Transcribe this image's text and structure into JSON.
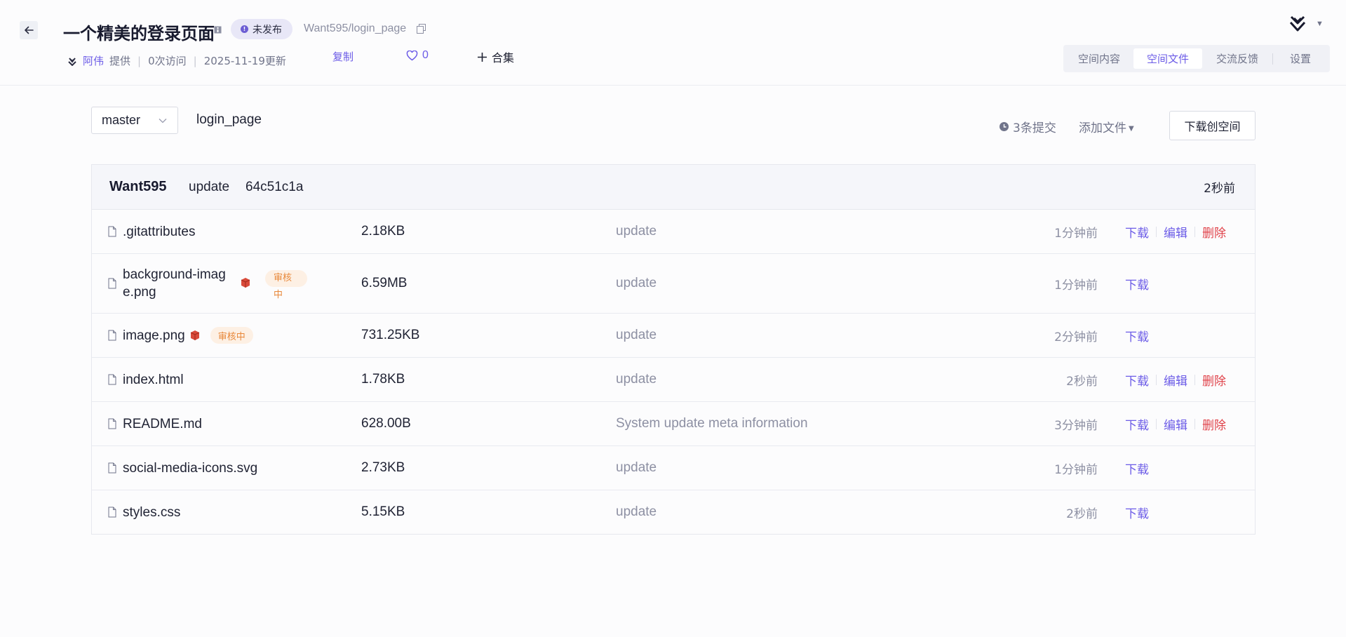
{
  "header": {
    "title": "一个精美的登录页面",
    "status": "未发布",
    "repo_path": "Want595/login_page",
    "author": "阿伟",
    "provide_label": "提供",
    "visits": "0次访问",
    "updated": "2025-11-19更新",
    "copy_label": "复制",
    "like_count": "0",
    "collection_label": "合集",
    "tabs": [
      {
        "label": "空间内容",
        "active": false
      },
      {
        "label": "空间文件",
        "active": true
      },
      {
        "label": "交流反馈",
        "active": false
      },
      {
        "label": "设置",
        "active": false
      }
    ]
  },
  "toolbar": {
    "branch": "master",
    "repo_name": "login_page",
    "commits_label": "3条提交",
    "add_file_label": "添加文件",
    "download_space_label": "下载创空间"
  },
  "latest_commit": {
    "author": "Want595",
    "message": "update",
    "hash": "64c51c1a",
    "time": "2秒前"
  },
  "actions": {
    "download": "下载",
    "edit": "编辑",
    "delete": "删除"
  },
  "review_label": "审核中",
  "files": [
    {
      "name": ".gitattributes",
      "size": "2.18KB",
      "message": "update",
      "time": "1分钟前",
      "editable": true
    },
    {
      "name": "background-image.png",
      "name_line1": "background-imag",
      "name_line2": "e.png",
      "size": "6.59MB",
      "message": "update",
      "time": "1分钟前",
      "editable": false,
      "lfs": true,
      "review": true
    },
    {
      "name": "image.png",
      "size": "731.25KB",
      "message": "update",
      "time": "2分钟前",
      "editable": false,
      "lfs": true,
      "review": true
    },
    {
      "name": "index.html",
      "size": "1.78KB",
      "message": "update",
      "time": "2秒前",
      "editable": true
    },
    {
      "name": "README.md",
      "size": "628.00B",
      "message": "System update meta information",
      "time": "3分钟前",
      "editable": true
    },
    {
      "name": "social-media-icons.svg",
      "size": "2.73KB",
      "message": "update",
      "time": "1分钟前",
      "editable": false
    },
    {
      "name": "styles.css",
      "size": "5.15KB",
      "message": "update",
      "time": "2秒前",
      "editable": false
    }
  ],
  "colors": {
    "accent": "#6c5ce7",
    "danger": "#e0424a",
    "review_bg": "#fdf0e4",
    "review_text": "#e8883a"
  },
  "icons": [
    "back-arrow-icon",
    "info-icon",
    "copy-icon",
    "heart-icon",
    "plus-icon",
    "avatar-logo-icon",
    "chevron-down-icon",
    "clock-icon",
    "file-icon",
    "lfs-box-icon"
  ]
}
